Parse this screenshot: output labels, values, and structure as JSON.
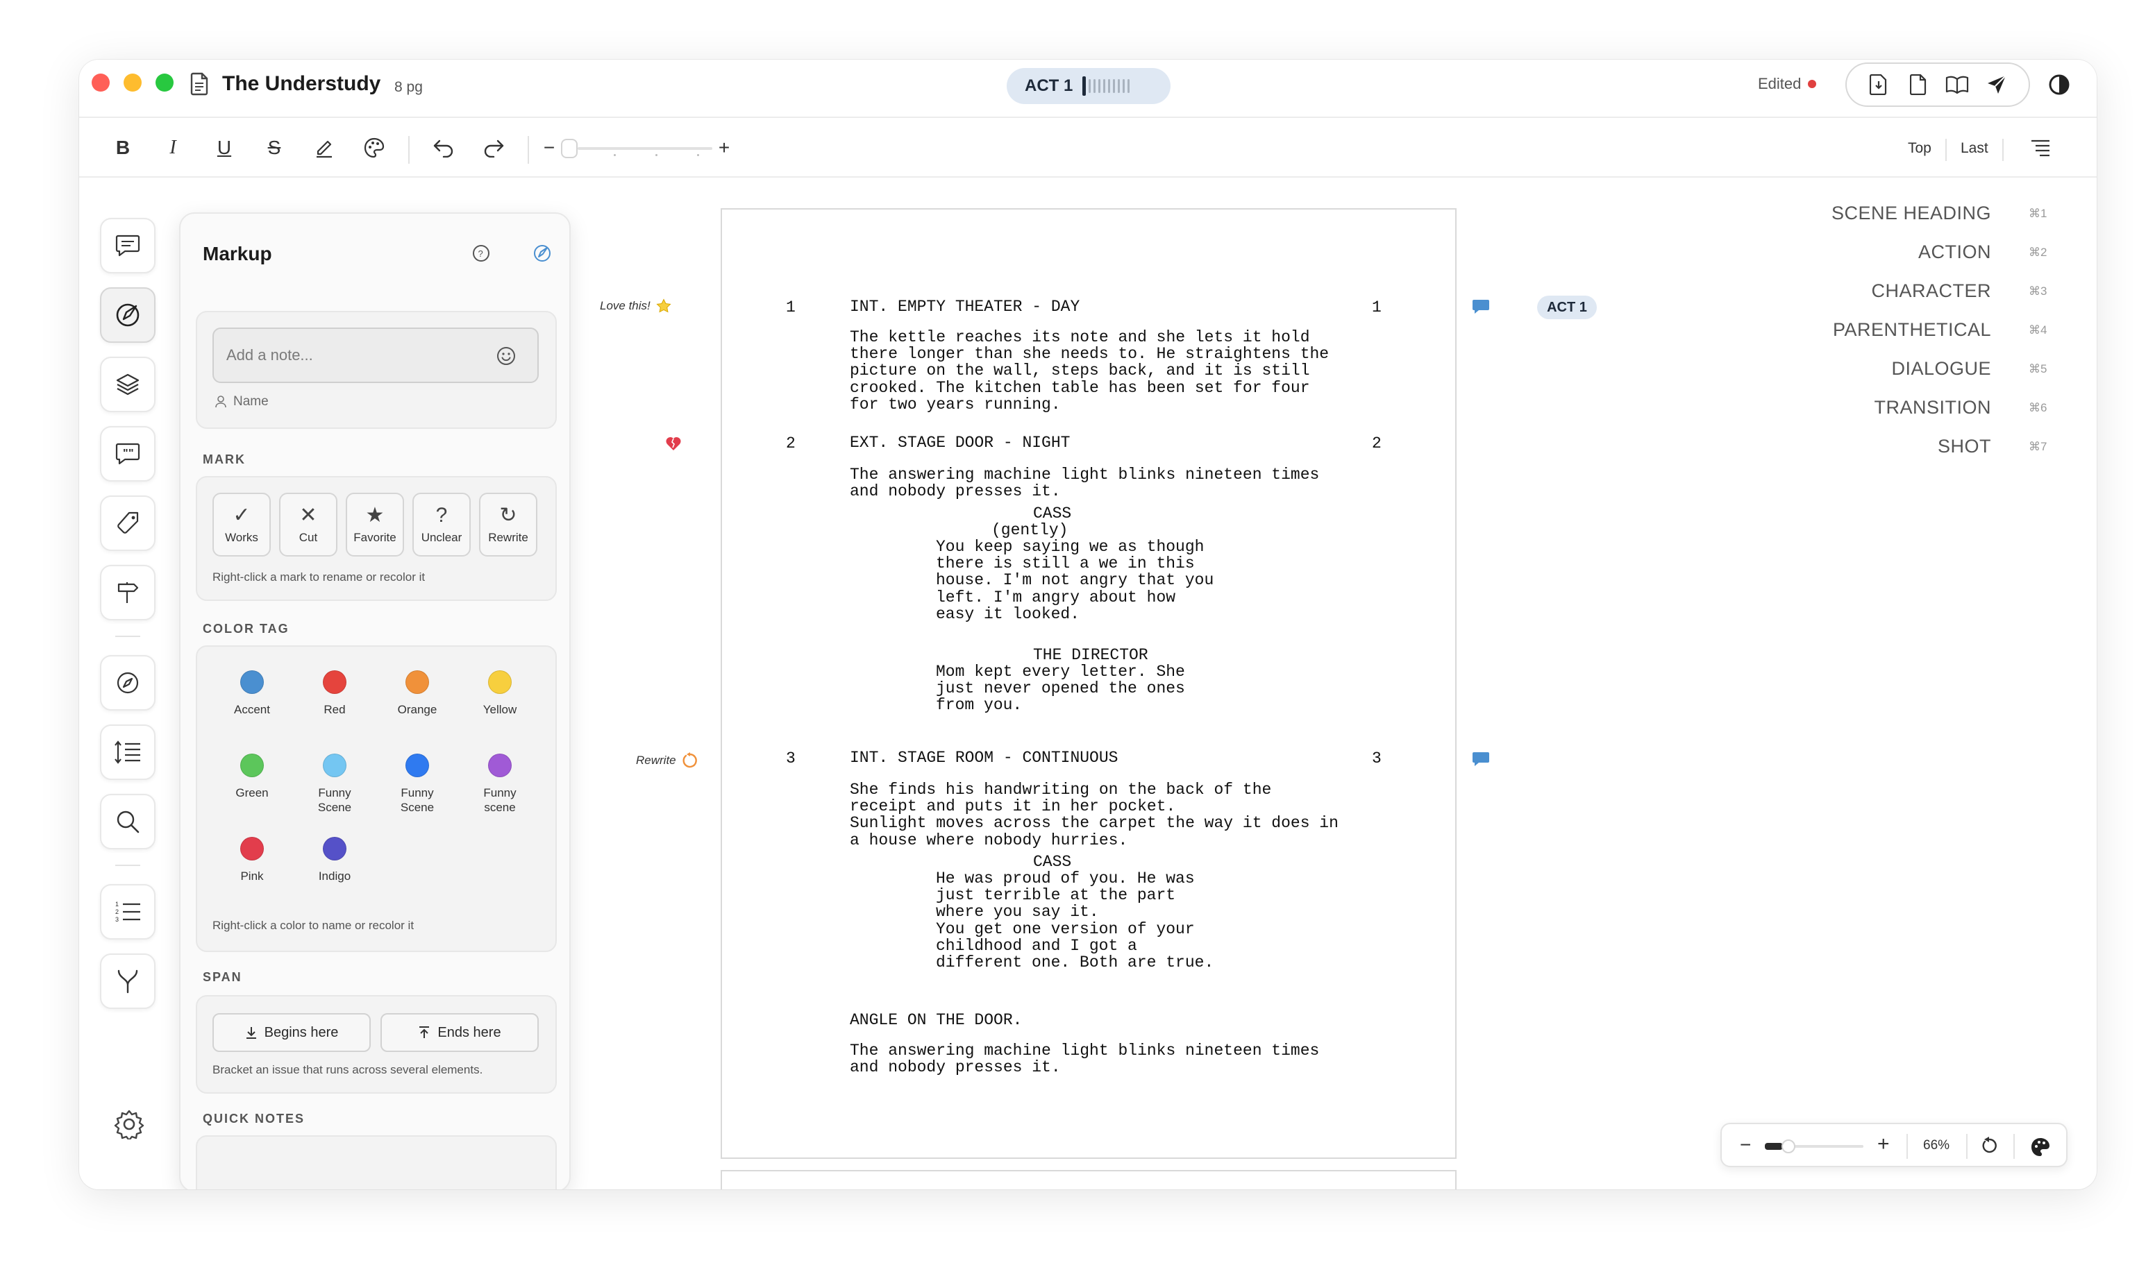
{
  "window": {
    "title": "The Understudy",
    "pages": "8 pg",
    "act_pill": "ACT 1",
    "edited_label": "Edited",
    "edited_dot_color": "#e0403f"
  },
  "titlebar_icons": [
    "export-pdf-icon",
    "document-icon",
    "book-icon",
    "send-icon",
    "contrast-icon"
  ],
  "toolbar": {
    "bold": "B",
    "italic": "I",
    "underline": "U",
    "strike": "S",
    "zoom_minus": "−",
    "zoom_plus": "+",
    "top_label": "Top",
    "last_label": "Last"
  },
  "markup_panel": {
    "title": "Markup",
    "note_placeholder": "Add a note...",
    "name_label": "Name",
    "mark_section": "MARK",
    "marks": [
      {
        "label": "Works",
        "glyph": "✓"
      },
      {
        "label": "Cut",
        "glyph": "✕"
      },
      {
        "label": "Favorite",
        "glyph": "★"
      },
      {
        "label": "Unclear",
        "glyph": "?"
      },
      {
        "label": "Rewrite",
        "glyph": "↻"
      }
    ],
    "mark_hint": "Right-click a mark to rename or recolor it",
    "color_section": "COLOR TAG",
    "colors": [
      {
        "label": "Accent",
        "color": "#4a8fd0"
      },
      {
        "label": "Red",
        "color": "#e5443d"
      },
      {
        "label": "Orange",
        "color": "#f0913a"
      },
      {
        "label": "Yellow",
        "color": "#f7cf3e"
      },
      {
        "label": "Green",
        "color": "#5cc65b"
      },
      {
        "label": "Funny\nScene",
        "color": "#74c6f2"
      },
      {
        "label": "Funny\nScene",
        "color": "#2f7af0"
      },
      {
        "label": "Funny\nscene",
        "color": "#a05ad6"
      },
      {
        "label": "Pink",
        "color": "#e23d4c"
      },
      {
        "label": "Indigo",
        "color": "#5551c8"
      }
    ],
    "color_hint": "Right-click a color to name or recolor it",
    "span_section": "SPAN",
    "span_begin": "Begins here",
    "span_end": "Ends here",
    "span_hint": "Bracket an issue that runs across several elements.",
    "quick_notes_section": "QUICK NOTES"
  },
  "margin_notes": {
    "love": "Love this!",
    "rewrite": "Rewrite"
  },
  "script": {
    "scene1": {
      "num": "1",
      "heading": "INT. EMPTY THEATER - DAY"
    },
    "action1": "The kettle reaches its note and she lets it hold\nthere longer than she needs to. He straightens the\npicture on the wall, steps back, and it is still\ncrooked. The kitchen table has been set for four\nfor two years running.",
    "scene2": {
      "num": "2",
      "heading": "EXT. STAGE DOOR - NIGHT"
    },
    "action2": "The answering machine light blinks nineteen times\nand nobody presses it.",
    "char1": "CASS",
    "paren1": "(gently)",
    "dialogue1": "You keep saying we as though\nthere is still a we in this\nhouse. I'm not angry that you\nleft. I'm angry about how\neasy it looked.",
    "char2": "THE DIRECTOR",
    "dialogue2": "Mom kept every letter. She\njust never opened the ones\nfrom you.",
    "scene3": {
      "num": "3",
      "heading": "INT. STAGE ROOM - CONTINUOUS"
    },
    "action3": "She finds his handwriting on the back of the\nreceipt and puts it in her pocket.\nSunlight moves across the carpet the way it does in\na house where nobody hurries.",
    "char3": "CASS",
    "dialogue3": "He was proud of you. He was\njust terrible at the part\nwhere you say it.\nYou get one version of your\nchildhood and I got a\ndifferent one. Both are true.",
    "shot1": "ANGLE ON THE DOOR.",
    "action4": "The answering machine light blinks nineteen times\nand nobody presses it."
  },
  "act_chip": "ACT 1",
  "elements": [
    {
      "label": "SCENE HEADING",
      "key": "⌘1"
    },
    {
      "label": "ACTION",
      "key": "⌘2"
    },
    {
      "label": "CHARACTER",
      "key": "⌘3"
    },
    {
      "label": "PARENTHETICAL",
      "key": "⌘4"
    },
    {
      "label": "DIALOGUE",
      "key": "⌘5"
    },
    {
      "label": "TRANSITION",
      "key": "⌘6"
    },
    {
      "label": "SHOT",
      "key": "⌘7"
    }
  ],
  "zoom": {
    "minus": "−",
    "plus": "+",
    "percent": "66%"
  },
  "colors": {
    "accent": "#4a8fd0",
    "comment": "#4a8fd0",
    "pill_bg": "#dfe8f3"
  }
}
